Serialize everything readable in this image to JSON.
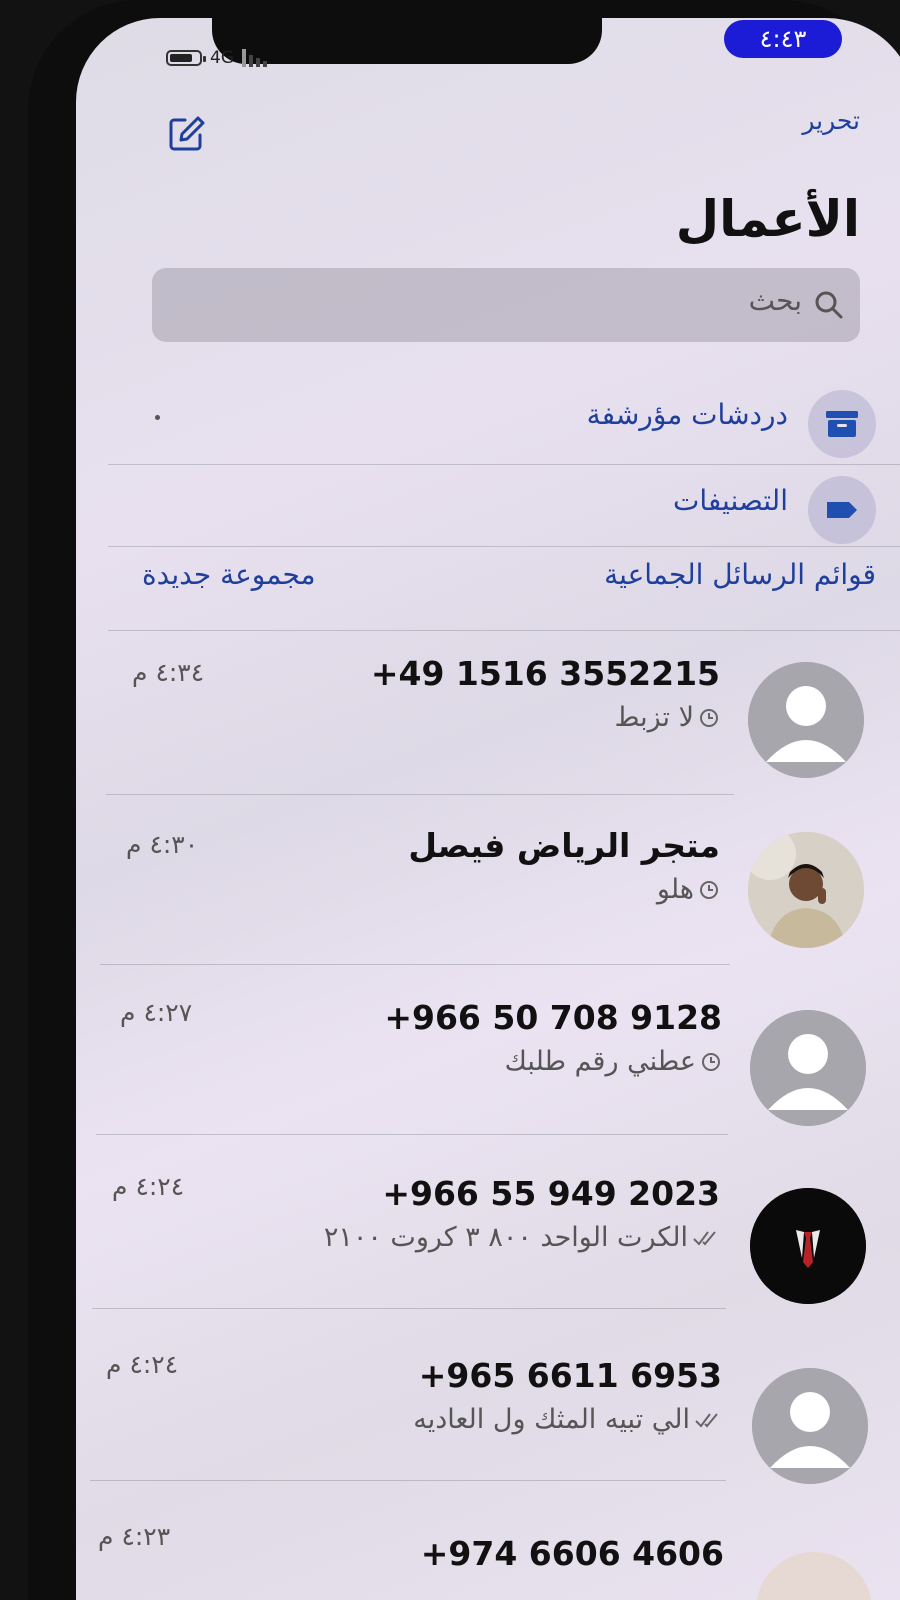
{
  "status_bar": {
    "time": "٤:٤٣",
    "network": "4G"
  },
  "header": {
    "edit_label": "تحرير",
    "title": "الأعمال",
    "compose_icon": "compose-icon"
  },
  "search": {
    "placeholder": "بحث",
    "icon": "search-icon"
  },
  "menu": [
    {
      "label": "دردشات مؤرشفة",
      "icon": "archive-icon"
    },
    {
      "label": "التصنيفات",
      "icon": "label-tag-icon"
    }
  ],
  "links": {
    "broadcast_lists": "قوائم الرسائل الجماعية",
    "new_group": "مجموعة جديدة"
  },
  "chats": [
    {
      "name": "+49 1516 3552215",
      "preview": "لا تزبط",
      "status": "clock-icon",
      "time": "٤:٣٤ م",
      "avatar": "default"
    },
    {
      "name": "متجر الرياض فيصل",
      "preview": "هلو",
      "status": "clock-icon",
      "time": "٤:٣٠ م",
      "avatar": "photo"
    },
    {
      "name": "+966 50 708 9128",
      "preview": "عطني رقم طلبك",
      "status": "clock-icon",
      "time": "٤:٢٧ م",
      "avatar": "default"
    },
    {
      "name": "+966 55 949 2023",
      "preview": "الكرت الواحد ٨٠٠ ٣ كروت ٢١٠٠",
      "status": "double-check-icon",
      "time": "٤:٢٤ م",
      "avatar": "dark"
    },
    {
      "name": "+965 6611 6953",
      "preview": "الي تبيه المثك ول العاديه",
      "status": "double-check-icon",
      "time": "٤:٢٤ م",
      "avatar": "default"
    },
    {
      "name": "+974 6606 4606",
      "preview": "",
      "status": "",
      "time": "٤:٢٣ م",
      "avatar": "photo"
    }
  ],
  "colors": {
    "accent": "#1f3f9c",
    "status_pill": "#1c1cd6",
    "avatar_grey": "#a7a6ad"
  }
}
